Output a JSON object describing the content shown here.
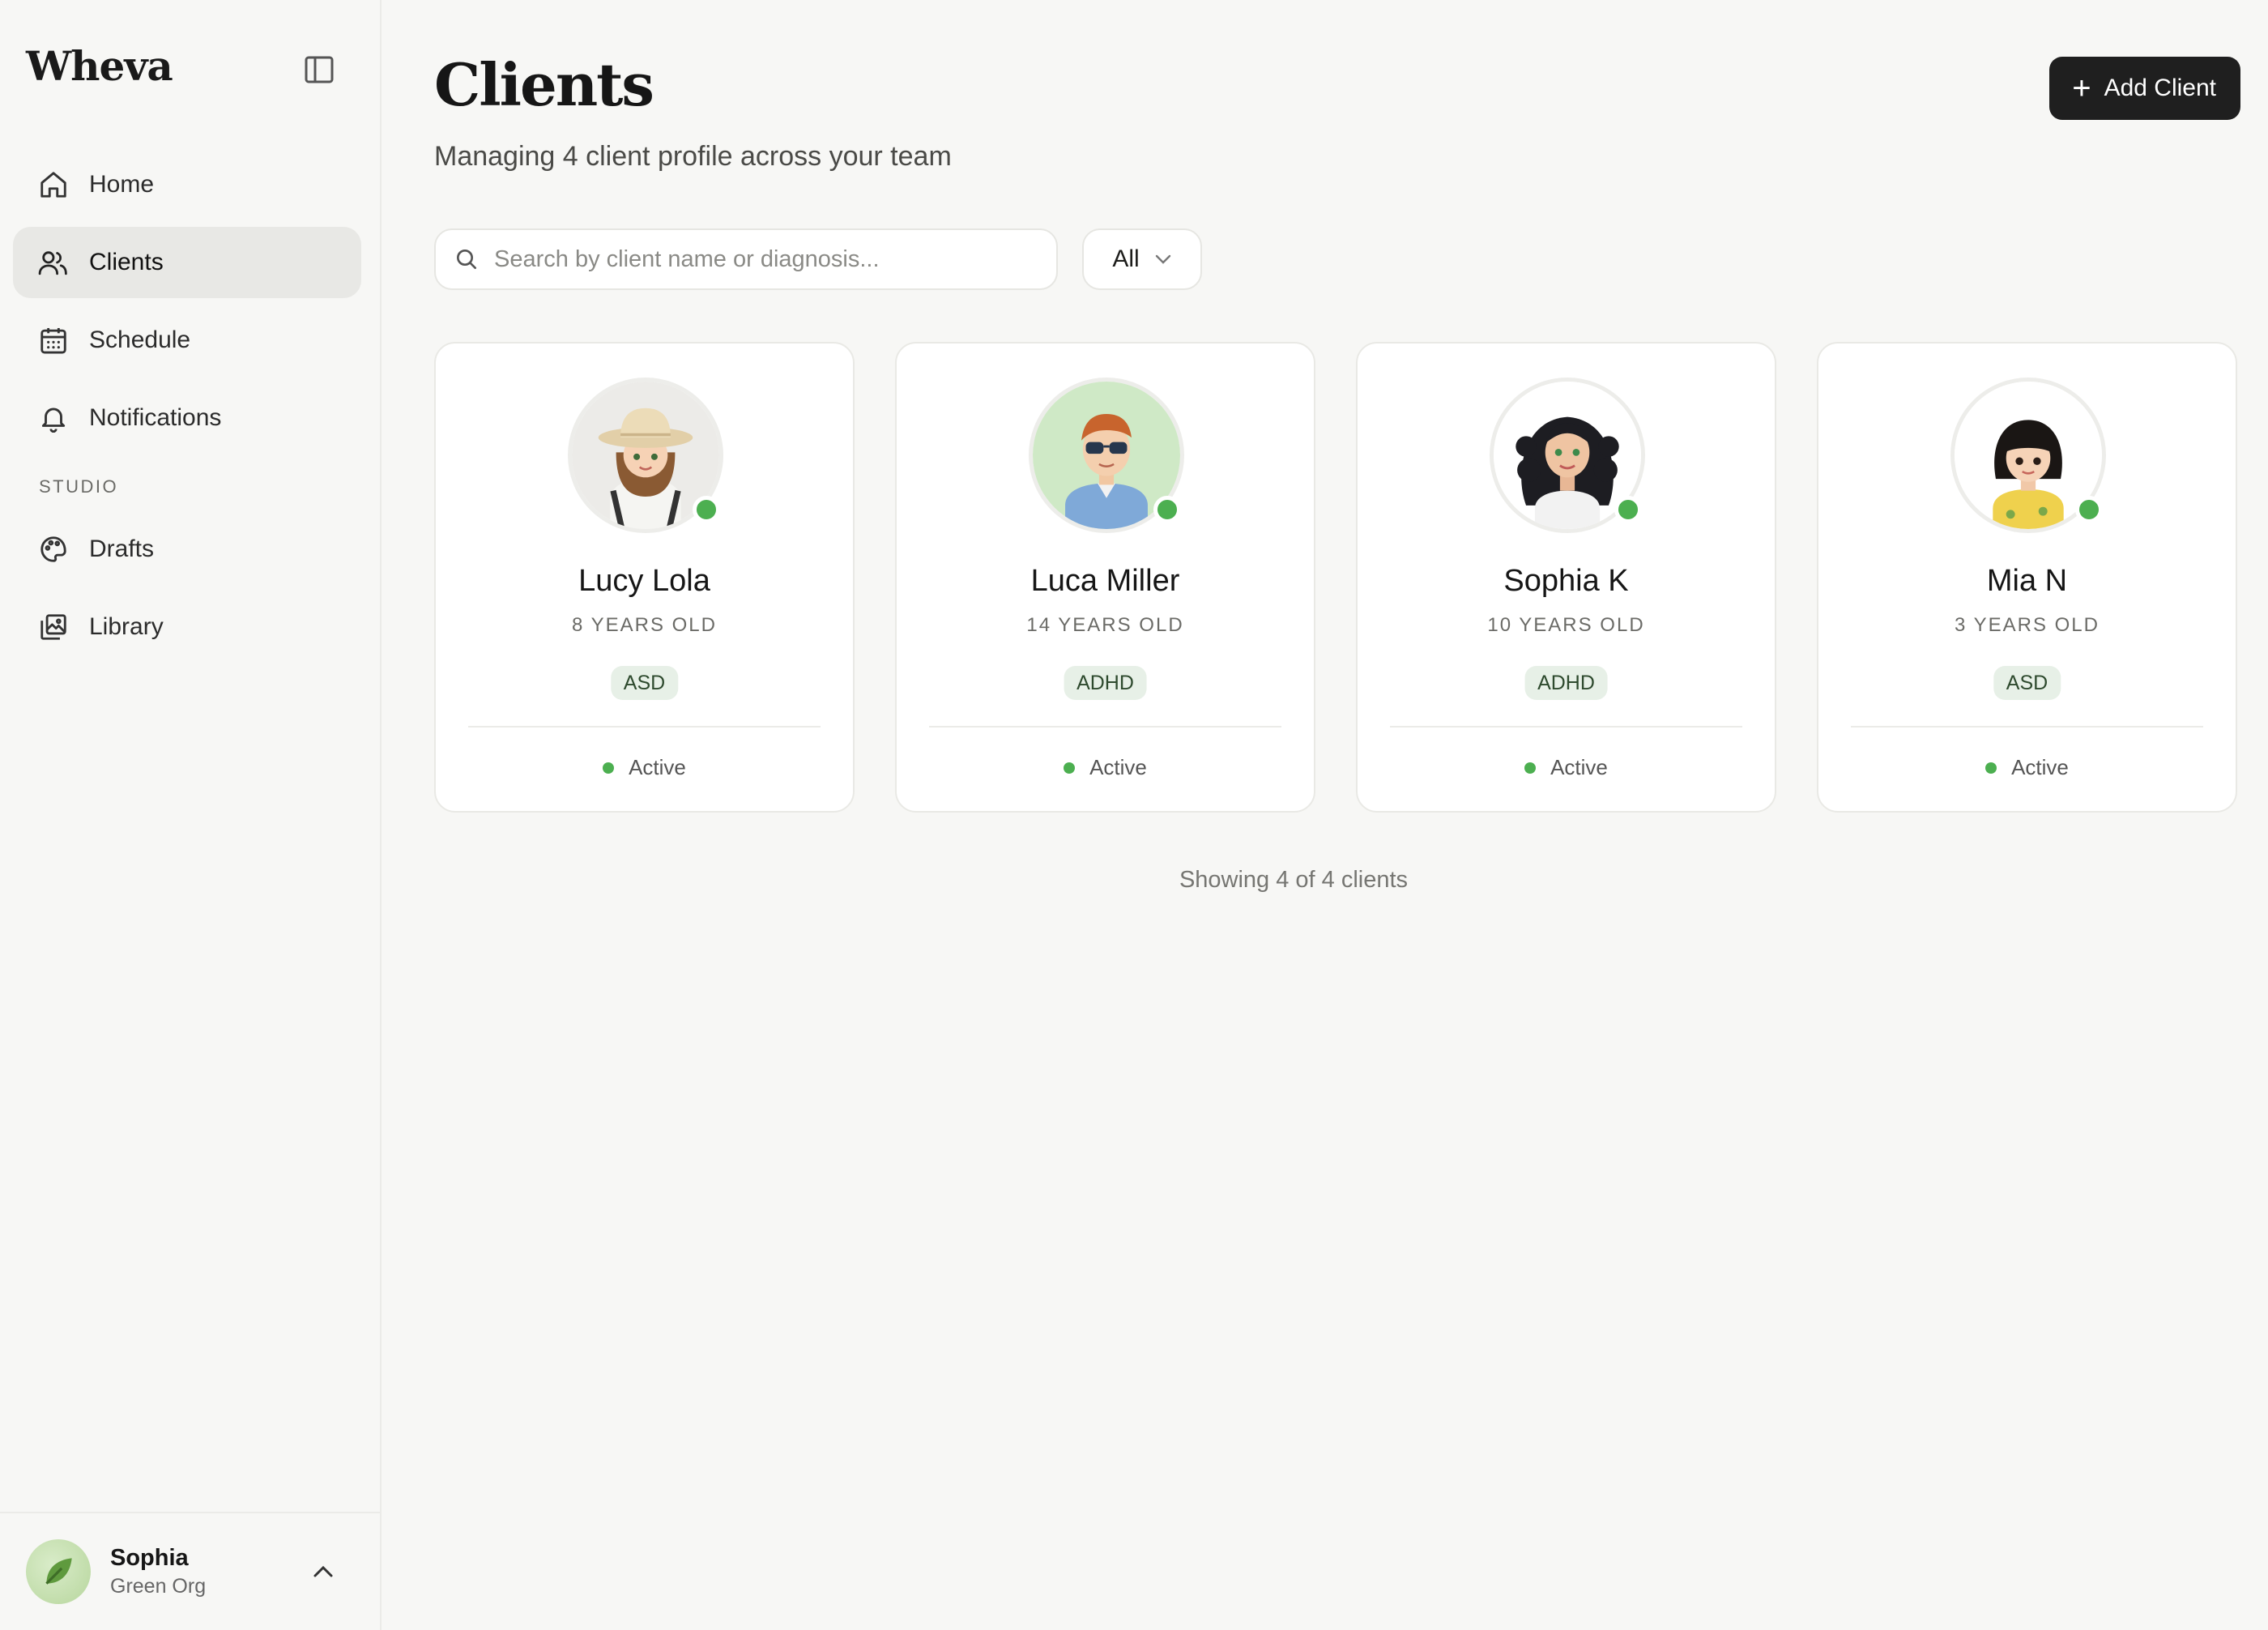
{
  "app": {
    "brand": "Wheva"
  },
  "sidebar": {
    "items": [
      {
        "label": "Home",
        "icon": "home-icon",
        "active": false
      },
      {
        "label": "Clients",
        "icon": "users-icon",
        "active": true
      },
      {
        "label": "Schedule",
        "icon": "calendar-icon",
        "active": false
      },
      {
        "label": "Notifications",
        "icon": "bell-icon",
        "active": false
      }
    ],
    "section_label": "STUDIO",
    "studio_items": [
      {
        "label": "Drafts",
        "icon": "palette-icon"
      },
      {
        "label": "Library",
        "icon": "library-icon"
      }
    ],
    "user": {
      "name": "Sophia",
      "org": "Green Org"
    }
  },
  "header": {
    "title": "Clients",
    "subtitle": "Managing 4 client profile across your team",
    "add_button": "Add Client"
  },
  "search": {
    "placeholder": "Search by client name or diagnosis..."
  },
  "filter": {
    "selected": "All"
  },
  "clients": [
    {
      "name": "Lucy Lola",
      "age": "8 YEARS OLD",
      "diagnosis": "ASD",
      "status": "Active",
      "avatar_bg": "#ecebe8"
    },
    {
      "name": "Luca Miller",
      "age": "14 YEARS OLD",
      "diagnosis": "ADHD",
      "status": "Active",
      "avatar_bg": "#cfe9c6"
    },
    {
      "name": "Sophia K",
      "age": "10 YEARS OLD",
      "diagnosis": "ADHD",
      "status": "Active",
      "avatar_bg": "#ffffff"
    },
    {
      "name": "Mia N",
      "age": "3 YEARS OLD",
      "diagnosis": "ASD",
      "status": "Active",
      "avatar_bg": "#ffffff"
    }
  ],
  "footer": {
    "count_text": "Showing 4 of 4 clients"
  },
  "colors": {
    "accent": "#1f1f1f",
    "online": "#4caf50",
    "badge_bg": "#e7f0e7",
    "active_nav": "#e8e8e5"
  }
}
